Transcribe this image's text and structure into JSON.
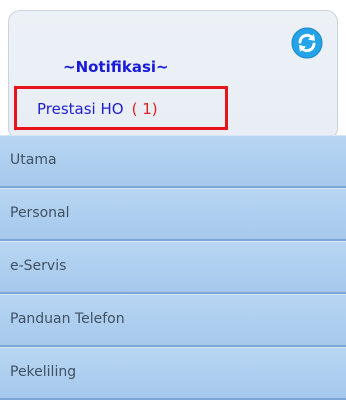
{
  "notification": {
    "title": "~Notifikasi~",
    "refresh_icon": "refresh-icon",
    "items": [
      {
        "label": "Prestasi HO",
        "count": "( 1)"
      }
    ]
  },
  "menu": {
    "items": [
      {
        "label": "Utama"
      },
      {
        "label": "Personal"
      },
      {
        "label": "e-Servis"
      },
      {
        "label": "Panduan Telefon"
      },
      {
        "label": "Pekeliling"
      }
    ]
  },
  "colors": {
    "notification_title": "#1a1adb",
    "highlight_border": "#e8141b",
    "count_text": "#e02323",
    "menu_background": "#aecdee",
    "menu_text": "#3f5163",
    "refresh_icon": "#23a3e8"
  }
}
